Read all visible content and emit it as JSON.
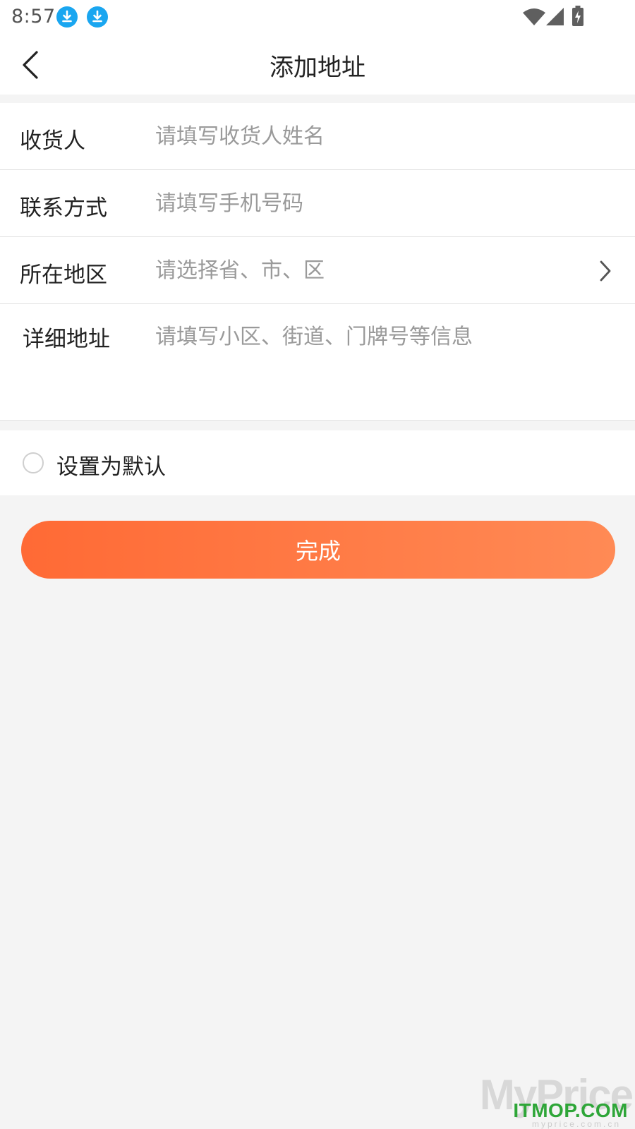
{
  "status_bar": {
    "time": "8:57",
    "notification_icons": [
      "download-icon",
      "download-icon"
    ],
    "system_icons": [
      "wifi-icon",
      "signal-icon",
      "battery-charging-icon"
    ]
  },
  "header": {
    "title": "添加地址",
    "back_icon": "chevron-left-icon"
  },
  "form": {
    "receiver": {
      "label": "收货人",
      "placeholder": "请填写收货人姓名",
      "value": ""
    },
    "phone": {
      "label": "联系方式",
      "placeholder": "请填写手机号码",
      "value": ""
    },
    "region": {
      "label": "所在地区",
      "placeholder": "请选择省、市、区",
      "value": "",
      "icon": "chevron-right-icon"
    },
    "address": {
      "label": "详细地址",
      "placeholder": "请填写小区、街道、门牌号等信息",
      "value": ""
    }
  },
  "default_option": {
    "label": "设置为默认",
    "checked": false
  },
  "submit": {
    "label": "完成"
  },
  "watermark": {
    "big": "MyPrice",
    "green": "ITMOP.COM",
    "small": "myprice.com.cn"
  },
  "colors": {
    "accent_start": "#ff6a35",
    "accent_end": "#ff8a55",
    "download_icon": "#1aa6f0",
    "background": "#f4f4f4"
  }
}
